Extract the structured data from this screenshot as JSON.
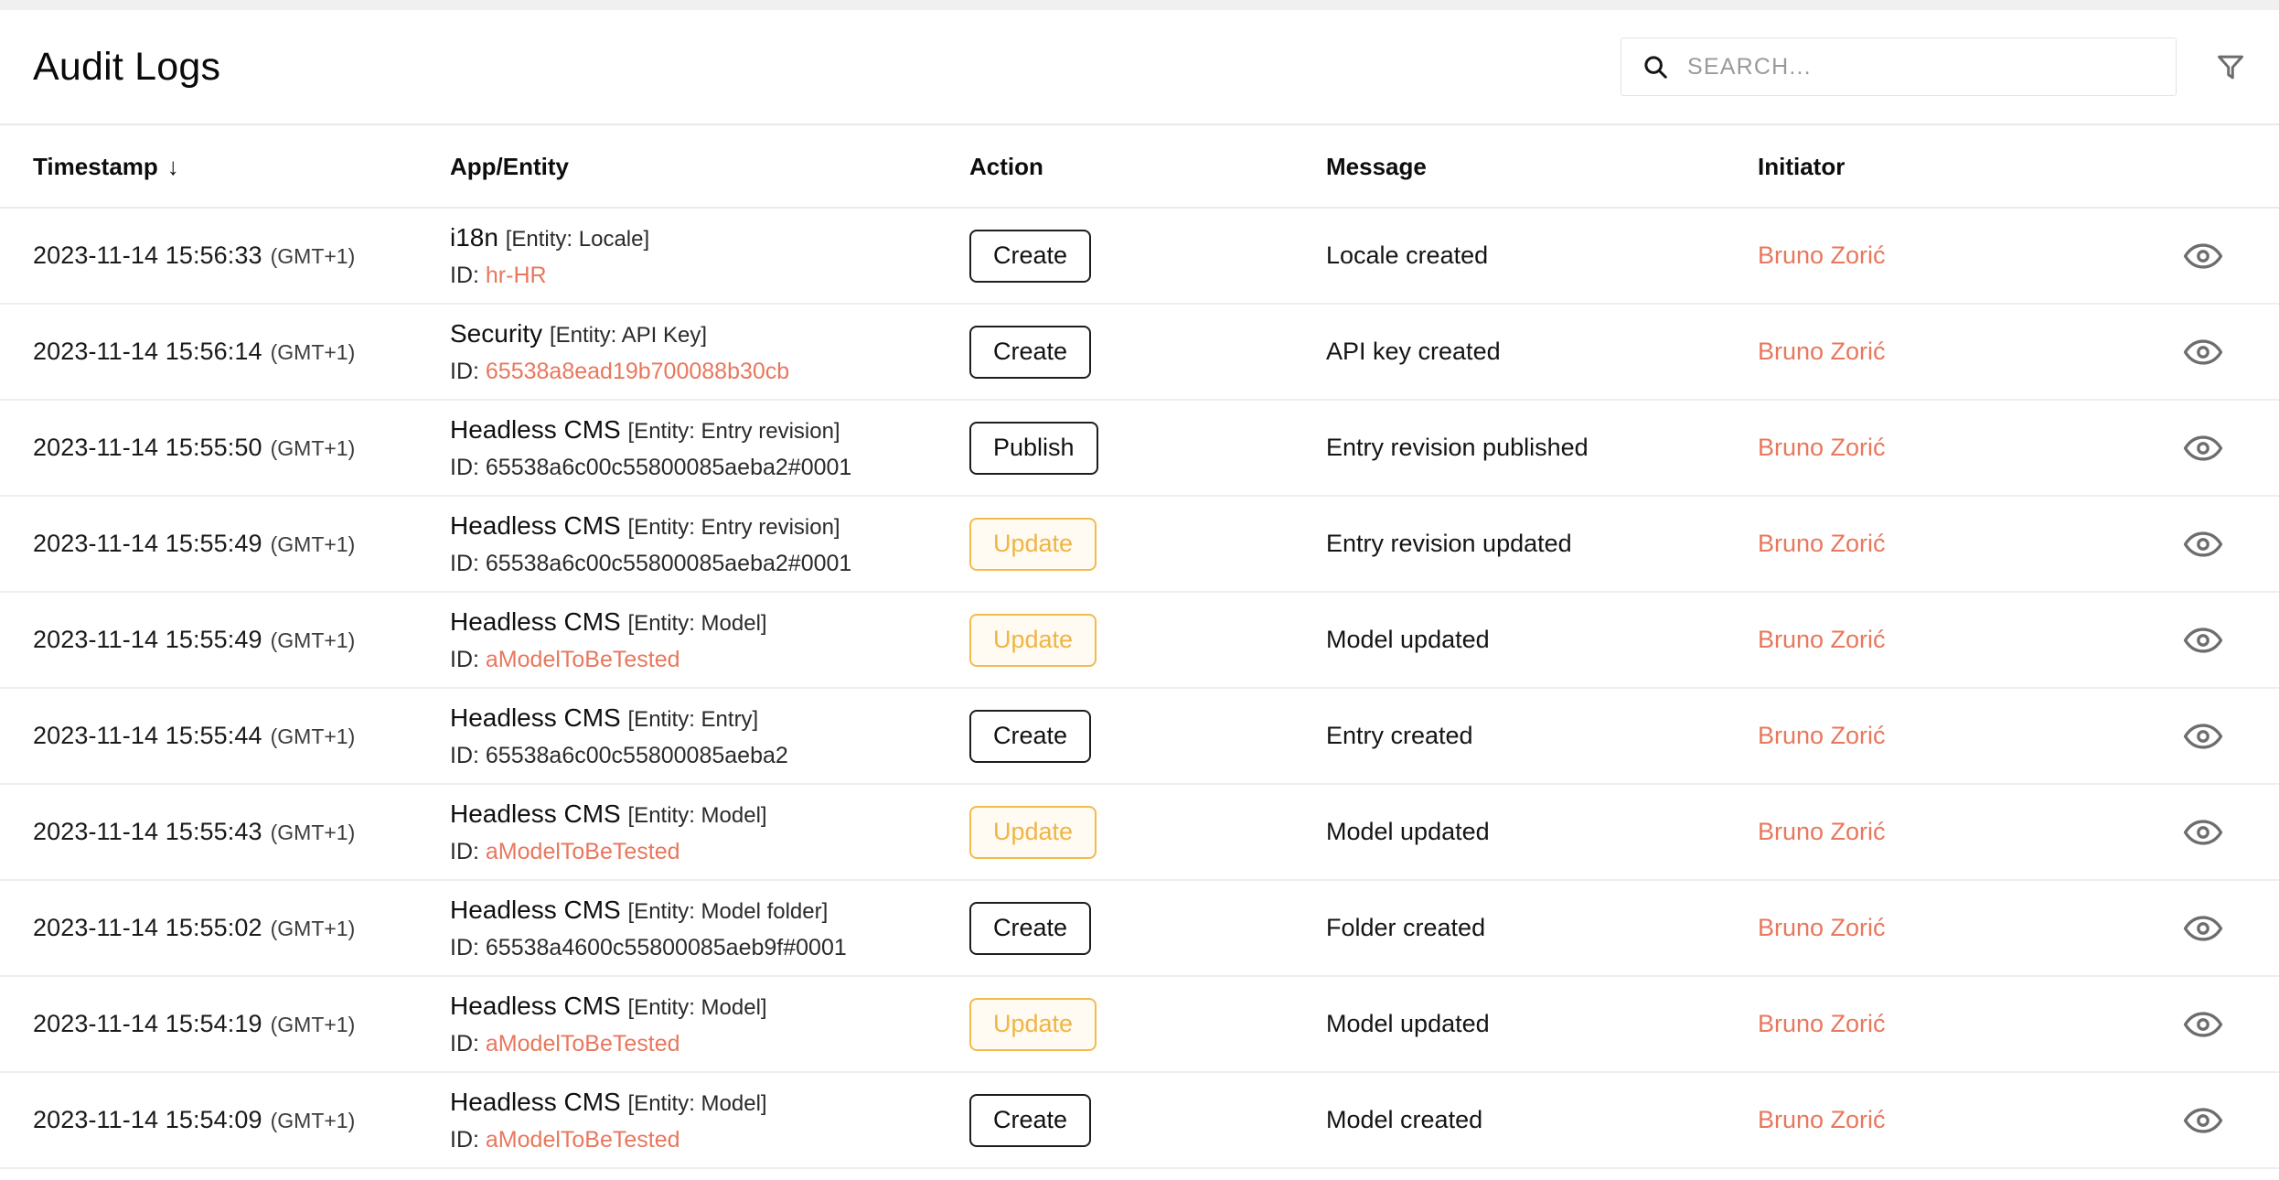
{
  "header": {
    "title": "Audit Logs",
    "search": {
      "placeholder": "SEARCH...",
      "value": "",
      "icon": "search-icon"
    },
    "filter_icon": "filter-funnel-icon"
  },
  "colors": {
    "link": "#e8775c",
    "action_update_border": "#f3bb4c",
    "action_update_text": "#f0b542",
    "action_update_bg": "#fffaf2",
    "action_default_border": "#1d1d1d",
    "row_divider": "#eeeeee",
    "page_bg": "#f0f0f0",
    "panel_bg": "#ffffff"
  },
  "table": {
    "columns": [
      {
        "key": "timestamp",
        "label": "Timestamp",
        "sorted": true,
        "sort_dir": "desc",
        "sort_glyph": "↓"
      },
      {
        "key": "app_entity",
        "label": "App/Entity"
      },
      {
        "key": "action",
        "label": "Action"
      },
      {
        "key": "message",
        "label": "Message"
      },
      {
        "key": "initiator",
        "label": "Initiator"
      },
      {
        "key": "view",
        "label": ""
      }
    ],
    "id_prefix": "ID:",
    "rows": [
      {
        "timestamp": "2023-11-14 15:56:33",
        "timezone": "(GMT+1)",
        "app": "i18n",
        "entity": "[Entity: Locale]",
        "entity_id": "hr-HR",
        "entity_id_is_link": true,
        "action": "Create",
        "action_style": "dark",
        "message": "Locale created",
        "initiator": "Bruno Zorić",
        "view_icon": "eye-icon"
      },
      {
        "timestamp": "2023-11-14 15:56:14",
        "timezone": "(GMT+1)",
        "app": "Security",
        "entity": "[Entity: API Key]",
        "entity_id": "65538a8ead19b700088b30cb",
        "entity_id_is_link": true,
        "action": "Create",
        "action_style": "dark",
        "message": "API key created",
        "initiator": "Bruno Zorić",
        "view_icon": "eye-icon"
      },
      {
        "timestamp": "2023-11-14 15:55:50",
        "timezone": "(GMT+1)",
        "app": "Headless CMS",
        "entity": "[Entity: Entry revision]",
        "entity_id": "65538a6c00c55800085aeba2#0001",
        "entity_id_is_link": false,
        "action": "Publish",
        "action_style": "dark",
        "message": "Entry revision published",
        "initiator": "Bruno Zorić",
        "view_icon": "eye-icon"
      },
      {
        "timestamp": "2023-11-14 15:55:49",
        "timezone": "(GMT+1)",
        "app": "Headless CMS",
        "entity": "[Entity: Entry revision]",
        "entity_id": "65538a6c00c55800085aeba2#0001",
        "entity_id_is_link": false,
        "action": "Update",
        "action_style": "amber",
        "message": "Entry revision updated",
        "initiator": "Bruno Zorić",
        "view_icon": "eye-icon"
      },
      {
        "timestamp": "2023-11-14 15:55:49",
        "timezone": "(GMT+1)",
        "app": "Headless CMS",
        "entity": "[Entity: Model]",
        "entity_id": "aModelToBeTested",
        "entity_id_is_link": true,
        "action": "Update",
        "action_style": "amber",
        "message": "Model updated",
        "initiator": "Bruno Zorić",
        "view_icon": "eye-icon"
      },
      {
        "timestamp": "2023-11-14 15:55:44",
        "timezone": "(GMT+1)",
        "app": "Headless CMS",
        "entity": "[Entity: Entry]",
        "entity_id": "65538a6c00c55800085aeba2",
        "entity_id_is_link": false,
        "action": "Create",
        "action_style": "dark",
        "message": "Entry created",
        "initiator": "Bruno Zorić",
        "view_icon": "eye-icon"
      },
      {
        "timestamp": "2023-11-14 15:55:43",
        "timezone": "(GMT+1)",
        "app": "Headless CMS",
        "entity": "[Entity: Model]",
        "entity_id": "aModelToBeTested",
        "entity_id_is_link": true,
        "action": "Update",
        "action_style": "amber",
        "message": "Model updated",
        "initiator": "Bruno Zorić",
        "view_icon": "eye-icon"
      },
      {
        "timestamp": "2023-11-14 15:55:02",
        "timezone": "(GMT+1)",
        "app": "Headless CMS",
        "entity": "[Entity: Model folder]",
        "entity_id": "65538a4600c55800085aeb9f#0001",
        "entity_id_is_link": false,
        "action": "Create",
        "action_style": "dark",
        "message": "Folder created",
        "initiator": "Bruno Zorić",
        "view_icon": "eye-icon"
      },
      {
        "timestamp": "2023-11-14 15:54:19",
        "timezone": "(GMT+1)",
        "app": "Headless CMS",
        "entity": "[Entity: Model]",
        "entity_id": "aModelToBeTested",
        "entity_id_is_link": true,
        "action": "Update",
        "action_style": "amber",
        "message": "Model updated",
        "initiator": "Bruno Zorić",
        "view_icon": "eye-icon"
      },
      {
        "timestamp": "2023-11-14 15:54:09",
        "timezone": "(GMT+1)",
        "app": "Headless CMS",
        "entity": "[Entity: Model]",
        "entity_id": "aModelToBeTested",
        "entity_id_is_link": true,
        "action": "Create",
        "action_style": "dark",
        "message": "Model created",
        "initiator": "Bruno Zorić",
        "view_icon": "eye-icon"
      }
    ]
  }
}
